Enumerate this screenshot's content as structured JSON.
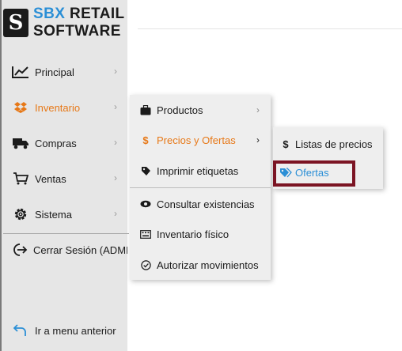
{
  "logo": {
    "mark": "S",
    "line1_blue": "SBX",
    "line1_rest": " RETAIL",
    "line2": "SOFTWARE"
  },
  "colors": {
    "accent_orange": "#e77817",
    "accent_blue": "#2b8fd6",
    "highlight_box": "#7b1423"
  },
  "sidebar": {
    "items": [
      {
        "label": "Principal",
        "icon": "chart-line-icon",
        "chevron": "›"
      },
      {
        "label": "Inventario",
        "icon": "dropbox-icon",
        "chevron": "›",
        "active": true
      },
      {
        "label": "Compras",
        "icon": "truck-icon",
        "chevron": "›"
      },
      {
        "label": "Ventas",
        "icon": "cart-icon",
        "chevron": "›"
      },
      {
        "label": "Sistema",
        "icon": "gear-icon",
        "chevron": "›"
      },
      {
        "label": "Cerrar Sesión (ADMIN)",
        "icon": "logout-icon"
      },
      {
        "label": "Ir a menu anterior",
        "icon": "back-arrow-icon"
      }
    ]
  },
  "submenu": {
    "items": [
      {
        "label": "Productos",
        "icon": "briefcase-icon",
        "chevron": "›"
      },
      {
        "label": "Precios y Ofertas",
        "icon": "dollar-icon",
        "chevron": "›",
        "active": true
      },
      {
        "label": "Imprimir etiquetas",
        "icon": "tag-icon"
      },
      {
        "label": "Consultar existencias",
        "icon": "eye-icon"
      },
      {
        "label": "Inventario físico",
        "icon": "keyboard-icon"
      },
      {
        "label": "Autorizar movimientos",
        "icon": "check-circle-icon"
      }
    ]
  },
  "subsubmenu": {
    "items": [
      {
        "label": "Listas de precios",
        "icon": "dollar-icon"
      },
      {
        "label": "Ofertas",
        "icon": "tags-icon",
        "active": true
      }
    ]
  }
}
